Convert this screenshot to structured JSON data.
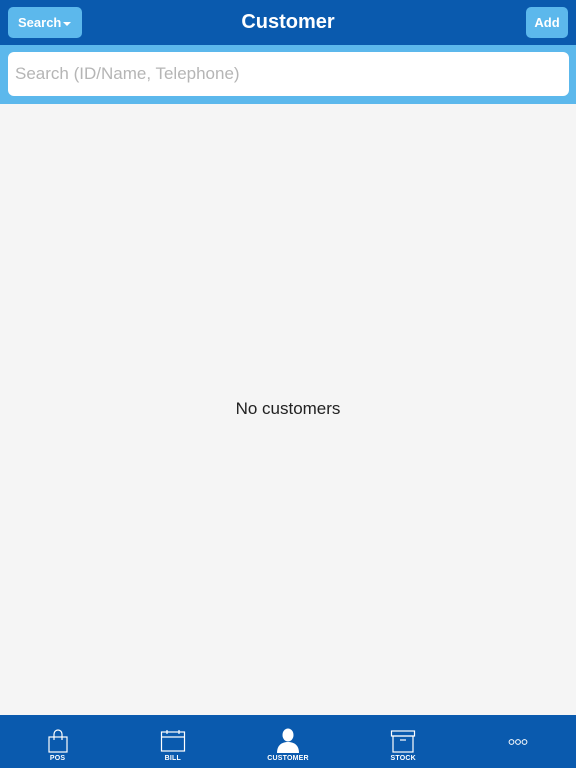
{
  "header": {
    "title": "Customer",
    "search_button": "Search",
    "add_button": "Add"
  },
  "search": {
    "placeholder": "Search (ID/Name, Telephone)",
    "value": ""
  },
  "main": {
    "empty_message": "No customers"
  },
  "tabbar": {
    "tabs": [
      {
        "label": "POS",
        "icon": "shopping-bag-icon"
      },
      {
        "label": "BILL",
        "icon": "calendar-icon"
      },
      {
        "label": "CUSTOMER",
        "icon": "person-icon",
        "active": true
      },
      {
        "label": "STOCK",
        "icon": "archive-box-icon"
      },
      {
        "label": "",
        "icon": "more-dots-icon"
      }
    ]
  },
  "colors": {
    "primary": "#0a5aae",
    "accent": "#5cb8ec",
    "background": "#f5f5f5"
  }
}
